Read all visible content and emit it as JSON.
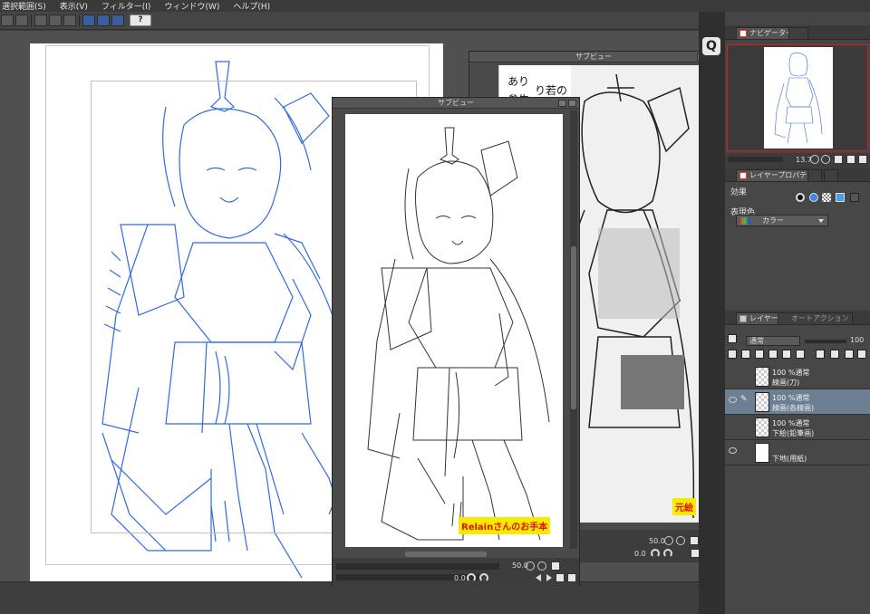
{
  "menubar": {
    "items": [
      {
        "label": "選択範囲(S)"
      },
      {
        "label": "表示(V)"
      },
      {
        "label": "フィルター(I)"
      },
      {
        "label": "ウィンドウ(W)"
      },
      {
        "label": "ヘルプ(H)"
      }
    ]
  },
  "toolbar": {
    "help_icon": "?"
  },
  "subview_center": {
    "title": "サブビュー",
    "zoom": "50.0",
    "rotation": "0.0",
    "caption": "Relainさんのお手本"
  },
  "subview_right": {
    "title": "サブビュー",
    "zoom": "50.0",
    "rotation": "0.0",
    "caption": "元絵",
    "manga_text_1": "あり",
    "manga_text_2": "参牛",
    "manga_text_3": "り若の"
  },
  "navigator": {
    "tab_label": "ナビゲーター",
    "zoom": "13.7"
  },
  "layer_property": {
    "tab_label": "レイヤープロパティ",
    "effect_label": "効果",
    "expression_color_label": "表現色",
    "expression_color_value": "カラー"
  },
  "layers_panel": {
    "tab_label": "レイヤー",
    "tab2_label": "オートアクション",
    "blend_mode": "通常",
    "opacity": "100",
    "layers": [
      {
        "line1": "100 %通常",
        "line2": "線画(刀)"
      },
      {
        "line1": "100 %通常",
        "line2": "線画(各線画)"
      },
      {
        "line1": "100 %通常",
        "line2": "下絵(鉛筆画)"
      },
      {
        "line1": "",
        "line2": "下地(用紙)"
      }
    ]
  },
  "dock": {
    "q_label": "Q"
  },
  "colors": {
    "sketch_blue": "#2f6be0",
    "label_yellow": "#f5ea00",
    "label_red": "#e01010",
    "active_layer": "#6c7f93",
    "nav_frame_red": "#d02020"
  }
}
